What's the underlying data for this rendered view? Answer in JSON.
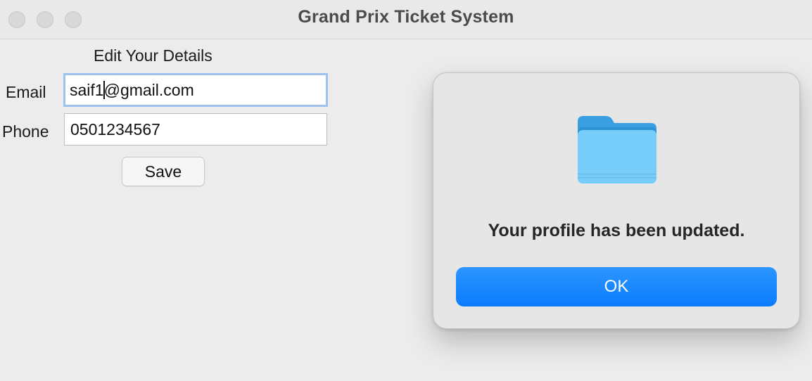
{
  "window": {
    "title": "Grand Prix Ticket System"
  },
  "form": {
    "heading": "Edit Your Details",
    "email_label": "Email",
    "email_value_before_caret": "saif1",
    "email_value_after_caret": "@gmail.com",
    "phone_label": "Phone",
    "phone_value": "0501234567",
    "save_label": "Save"
  },
  "dialog": {
    "icon": "folder-icon",
    "message": "Your profile has been updated.",
    "ok_label": "OK"
  },
  "colors": {
    "accent": "#0a7cff",
    "focus_ring": "#9ec1ee",
    "folder": "#6ec6f7"
  }
}
